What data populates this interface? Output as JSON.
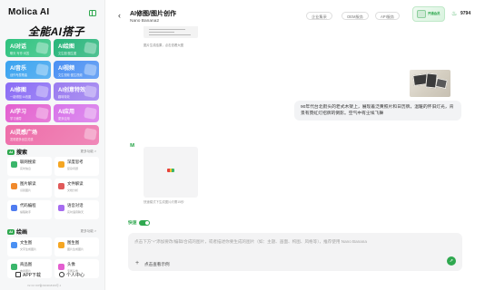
{
  "sidebar": {
    "brand": "Molica AI",
    "slogan": "全能AI搭子",
    "tiles": [
      {
        "label": "AI对话",
        "sub": "聊天·写作·问答",
        "color": "#2ec27e"
      },
      {
        "label": "AI绘图",
        "sub": "文生图·图生图",
        "color": "#27b57a"
      },
      {
        "label": "AI音乐",
        "sub": "创作专属歌曲",
        "color": "#3aa3f0"
      },
      {
        "label": "AI视频",
        "sub": "文生视频·图生视频",
        "color": "#4a90f3"
      },
      {
        "label": "AI修图",
        "sub": "一键修图·AI改图",
        "color": "#8a6cf5"
      },
      {
        "label": "AI创意特效",
        "sub": "趣味特效",
        "color": "#9a7bf0"
      },
      {
        "label": "AI学习",
        "sub": "学习辅导",
        "color": "#e35fd0"
      },
      {
        "label": "AI应用",
        "sub": "更多应用",
        "color": "#d874ea"
      },
      {
        "label": "AI灵感广场",
        "sub": "发现更多创意灵感",
        "color": "#ee6da9"
      }
    ],
    "section1": {
      "badge": "AI",
      "title": "搜索",
      "more": "更多功能 >"
    },
    "section1_items": [
      {
        "label": "联网搜索",
        "sub": "实时信息",
        "color": "#3ab66b"
      },
      {
        "label": "深度思考",
        "sub": "复杂问题",
        "color": "#f5a623"
      },
      {
        "label": "图片解读",
        "sub": "识别图片",
        "color": "#f08a2c"
      },
      {
        "label": "文件解读",
        "sub": "文档分析",
        "color": "#e05a5a"
      },
      {
        "label": "代码编程",
        "sub": "编程助手",
        "color": "#4f7cf0"
      },
      {
        "label": "语音对话",
        "sub": "实时语音聊天",
        "color": "#a66cf0"
      }
    ],
    "section2": {
      "badge": "AI",
      "title": "绘画",
      "more": "更多功能 >"
    },
    "section2_items": [
      {
        "label": "文生图",
        "sub": "文字生成图片",
        "color": "#4a90f3"
      },
      {
        "label": "图生图",
        "sub": "图片生成图片",
        "color": "#f5a623"
      },
      {
        "label": "商品图",
        "sub": "电商图片",
        "color": "#3ab66b"
      },
      {
        "label": "头像",
        "sub": "专属头像",
        "color": "#e35fd0"
      }
    ],
    "app_download": "APP下载",
    "user_center": "个人中心",
    "version": "V2.3.0 ICP备2024018403号-1"
  },
  "header": {
    "title": "AI修图/图片创作",
    "subtitle": "Nano Banana2",
    "buttons": [
      "企业集采",
      "OEM服务",
      "API服务"
    ],
    "vip_text": "开通会员",
    "points": "9794"
  },
  "chat": {
    "top_caption": "图片生成结果，点击查看大图",
    "user_message": "90年代台北街头的老式木架上，展现着泛黄照片和日历牌，温暖的怀旧灯光，背景有霓虹灯招牌的倒影。空气中有尘埃飞舞",
    "result_caption": "快速模式下生成图片约需15秒",
    "result_colors": [
      "#e7423b",
      "#f2c12e",
      "#3ab66b"
    ]
  },
  "composer": {
    "quick_label": "快速",
    "placeholder": "点击下方“+”添加要改/编辑/合成的图片，或者描述你要生成的图片（如：主题、画面、构图、风格等），推荐使用 Nano Banana",
    "examples_link": "点击查看示例",
    "send_icon": "arrow-up-icon"
  }
}
